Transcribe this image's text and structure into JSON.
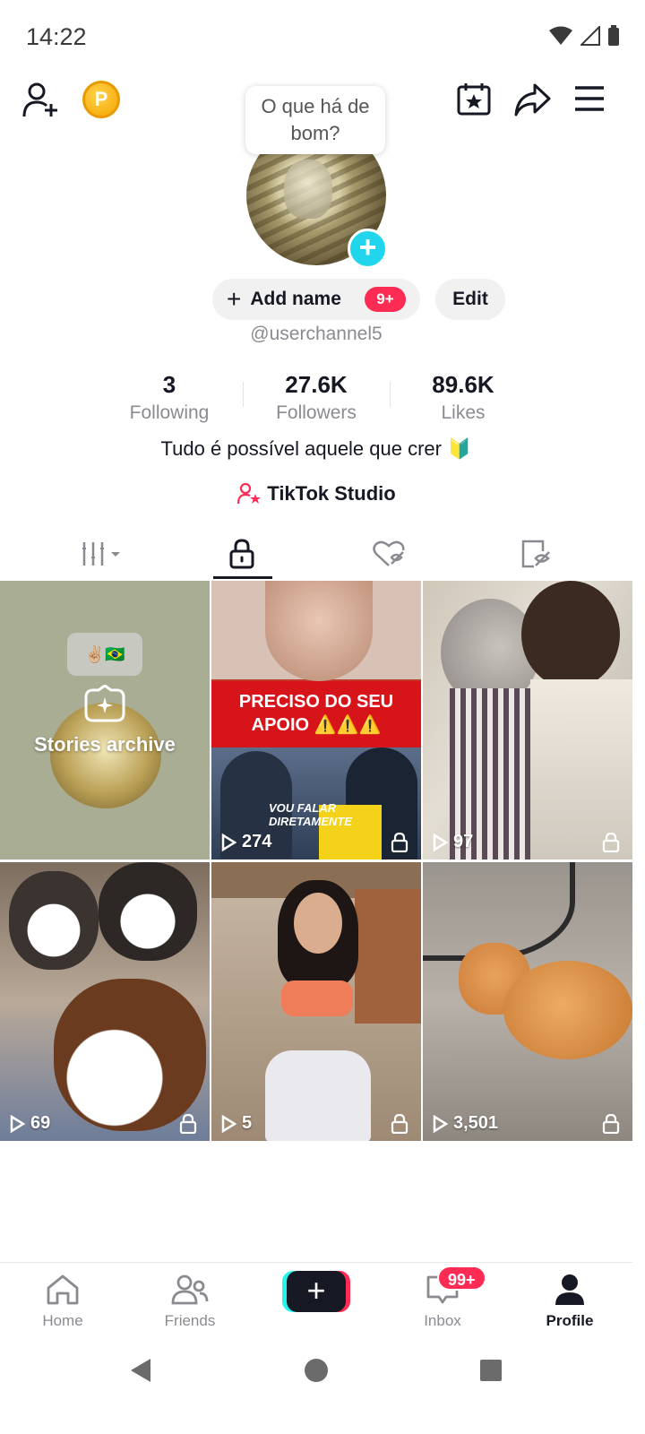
{
  "status_bar": {
    "time": "14:22"
  },
  "tooltip": {
    "text": "O que há de bom?"
  },
  "profile": {
    "add_name_label": "Add name",
    "add_name_badge": "9+",
    "edit_label": "Edit",
    "username": "@userchannel5",
    "bio": "Tudo é possível aquele que crer 🔰",
    "studio_label": "TikTok Studio"
  },
  "stats": [
    {
      "value": "3",
      "label": "Following"
    },
    {
      "value": "27.6K",
      "label": "Followers"
    },
    {
      "value": "89.6K",
      "label": "Likes"
    }
  ],
  "tabs": [
    "videos-grid",
    "private",
    "liked",
    "favorites-hidden"
  ],
  "grid": {
    "stories_label": "Stories archive",
    "stories_emoji": "✌🏼🇧🇷",
    "videos": [
      {
        "views": "274",
        "banner": "PRECISO DO SEU APOIO ⚠️⚠️⚠️",
        "caption": "VOU FALAR DIRETAMENTE"
      },
      {
        "views": "97"
      },
      {
        "views": "69"
      },
      {
        "views": "5"
      },
      {
        "views": "3,501"
      }
    ]
  },
  "bottom_nav": {
    "home": "Home",
    "friends": "Friends",
    "inbox": "Inbox",
    "inbox_badge": "99+",
    "profile": "Profile"
  },
  "colors": {
    "accent": "#fe2c55",
    "cyan": "#20d5ec",
    "text": "#161823",
    "muted": "#8a8b91"
  }
}
